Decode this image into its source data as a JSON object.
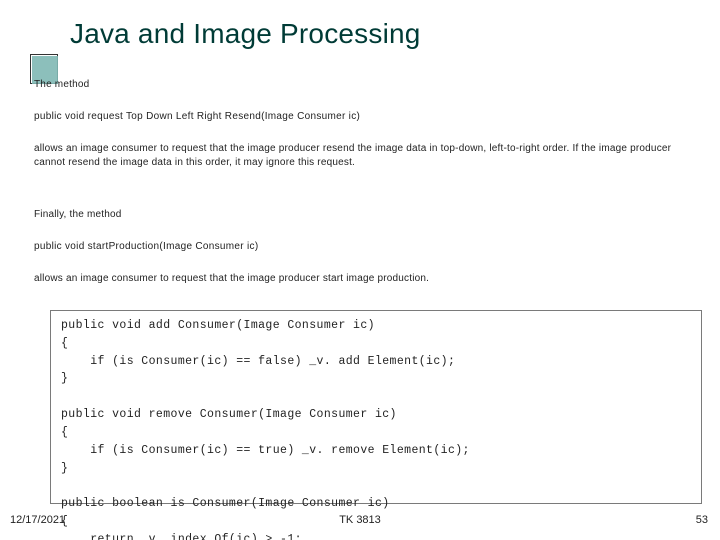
{
  "title": "Java and Image Processing",
  "paragraphs": {
    "intro": "The method",
    "sig1": "public void request Top Down Left Right Resend(Image Consumer ic)",
    "desc1": "allows an image consumer to request that the image producer resend the image data in top-down, left-to-right order. If the image producer cannot resend the image data in this order, it may ignore this request.",
    "finally": "Finally, the method",
    "sig2": "public void startProduction(Image Consumer ic)",
    "desc2": "allows an image consumer to request that the image producer start image production."
  },
  "code": "public void add Consumer(Image Consumer ic)\n{\n    if (is Consumer(ic) == false) _v. add Element(ic);\n}\n\npublic void remove Consumer(Image Consumer ic)\n{\n    if (is Consumer(ic) == true) _v. remove Element(ic);\n}\n\npublic boolean is Consumer(Image Consumer ic)\n{\n    return _v. index Of(ic) > -1;",
  "footer": {
    "date": "12/17/2021",
    "course": "TK 3813",
    "page": "53"
  }
}
